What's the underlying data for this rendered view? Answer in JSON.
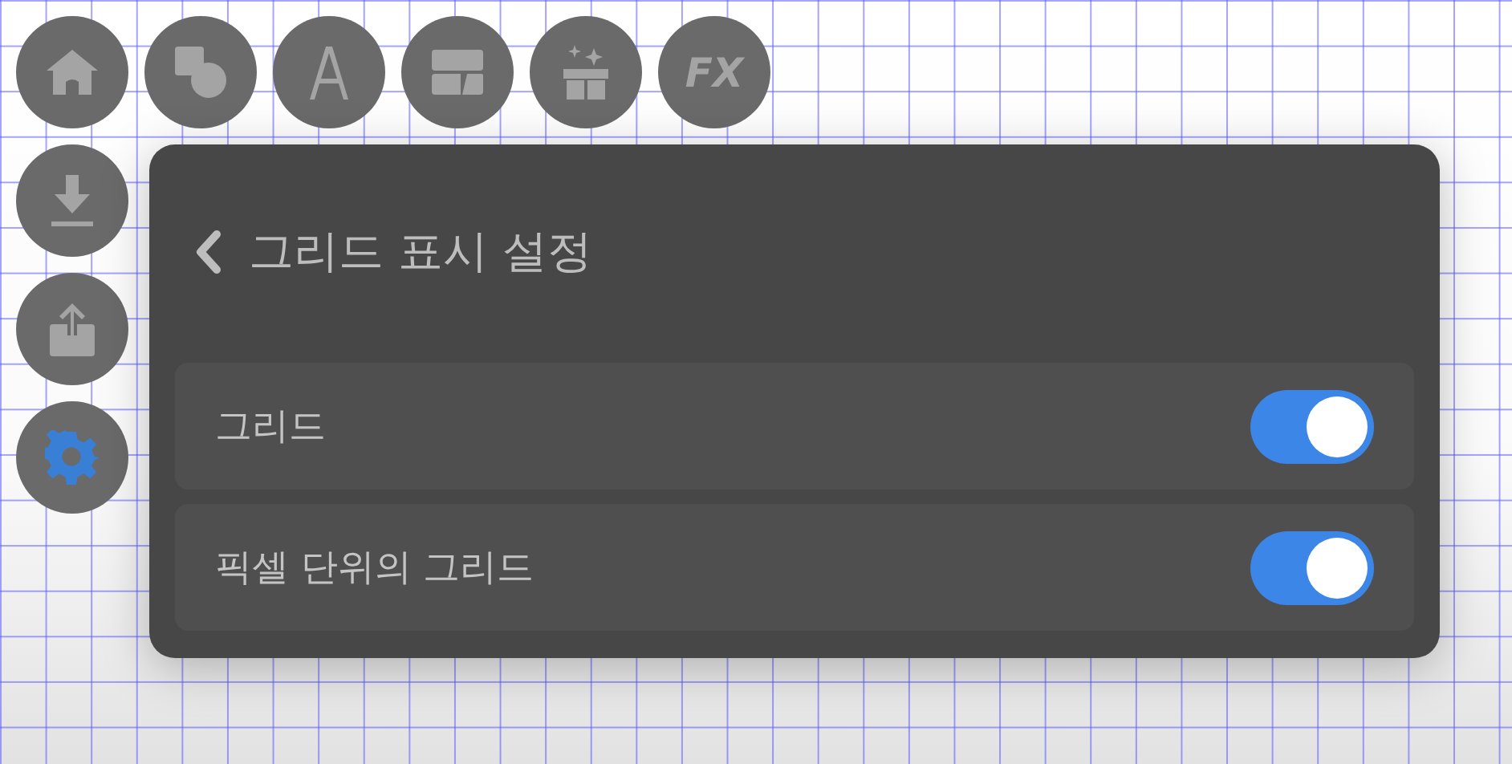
{
  "toolbar": [
    {
      "kind": "home",
      "selected": false
    },
    {
      "kind": "shapes",
      "selected": false
    },
    {
      "kind": "text",
      "selected": false
    },
    {
      "kind": "layout",
      "selected": false
    },
    {
      "kind": "gift",
      "selected": false
    },
    {
      "kind": "fx",
      "label": "FX",
      "selected": false
    }
  ],
  "side_toolbar": [
    {
      "kind": "download",
      "selected": false
    },
    {
      "kind": "share",
      "selected": false
    },
    {
      "kind": "settings",
      "selected": true
    }
  ],
  "panel": {
    "title": "그리드 표시 설정",
    "settings": [
      {
        "label": "그리드",
        "on": true
      },
      {
        "label": "픽셀 단위의 그리드",
        "on": true
      }
    ]
  }
}
